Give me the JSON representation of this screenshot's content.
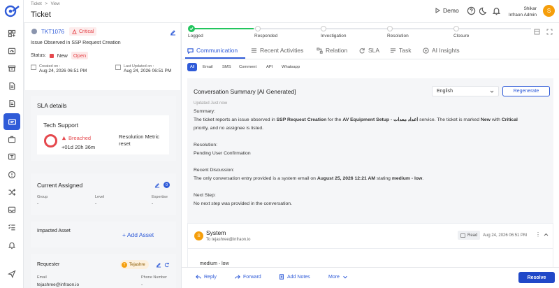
{
  "header": {
    "breadcrumb": [
      "Ticket",
      "View"
    ],
    "breadcrumb_sep": ">",
    "title": "Ticket",
    "demo_label": "Demo",
    "user_name": "Shikar",
    "user_org": "Infraon Admin",
    "avatar_initial": "S"
  },
  "ticket": {
    "id": "TKT1076",
    "priority": "Critical",
    "subject": "Issue Observed in SSP Request Creation",
    "status_label": "Status:",
    "status_value": "New",
    "status_badge": "Open",
    "created_label": "Created on :",
    "created_value": "Aug 24, 2026 06:51 PM",
    "updated_label": "Last Updated on :",
    "updated_value": "Aug 24, 2026 06:51 PM"
  },
  "sla": {
    "title": "SLA details",
    "group": "Tech Support",
    "state": "Breached",
    "duration": "+01d 20h 36m",
    "metric": "Resolution Metric reset"
  },
  "assigned": {
    "title": "Current Assigned",
    "count": "0",
    "cols": [
      {
        "label": "Group",
        "value": "-"
      },
      {
        "label": "Level",
        "value": "-"
      },
      {
        "label": "Expertise",
        "value": "-"
      }
    ]
  },
  "asset": {
    "title": "Impacted Asset",
    "add_label": "+  Add Asset"
  },
  "requester": {
    "title": "Requester",
    "tag": "Tejashre",
    "tag_initial": "T",
    "email_label": "Email",
    "email_value": "tejashree@infraon.io",
    "phone_label": "Phone Number",
    "phone_value": "-"
  },
  "stepper": [
    "Logged",
    "Responded",
    "Investigation",
    "Resolution",
    "Closure"
  ],
  "tabs": [
    "Communication",
    "Recent Activities",
    "Relation",
    "SLA",
    "Task",
    "AI Insights"
  ],
  "channels": [
    "All",
    "Email",
    "SMS",
    "Comment",
    "API",
    "Whatsapp"
  ],
  "summary": {
    "title": "Conversation Summary [AI Generated]",
    "language": "English",
    "regenerate": "Regenerate",
    "updated": "Updated Just now",
    "summary_h": "Summary:",
    "summary_p1a": "The ticket reports an issue observed in ",
    "summary_b1": "SSP Request Creation",
    "summary_p1b": " for the ",
    "summary_b2": "AV Equipment Setup - اعداد معدات",
    "summary_p1c": " service. The ticket is marked ",
    "summary_b3": "New",
    "summary_p1d": " with ",
    "summary_b4": "Critical",
    "summary_p2": "priority, and no assignee is listed.",
    "resolution_h": "Resolution:",
    "resolution_p": "Pending User Confirmation",
    "recent_h": "Recent Discussion:",
    "recent_a": "The only conversation entry provided is a system email on ",
    "recent_b1": "August 25, 2026 12:21 AM",
    "recent_c": " stating ",
    "recent_b2": "medium - low",
    "recent_d": ".",
    "next_h": "Next Step:",
    "next_p": "No next step was provided in the conversation."
  },
  "message": {
    "sender": "System",
    "initial": "S",
    "to": "To tejashree@infraon.io",
    "read": "Read",
    "time": "Aug 24, 2026 06:51 PM",
    "body": "medium - low"
  },
  "footer": {
    "reply": "Reply",
    "forward": "Forward",
    "add_notes": "Add Notes",
    "more": "More",
    "resolve": "Resolve"
  },
  "colors": {
    "primary": "#2f5bd8",
    "critical": "#e5484d",
    "success": "#22c55e",
    "avatar": "#f59e0b"
  }
}
